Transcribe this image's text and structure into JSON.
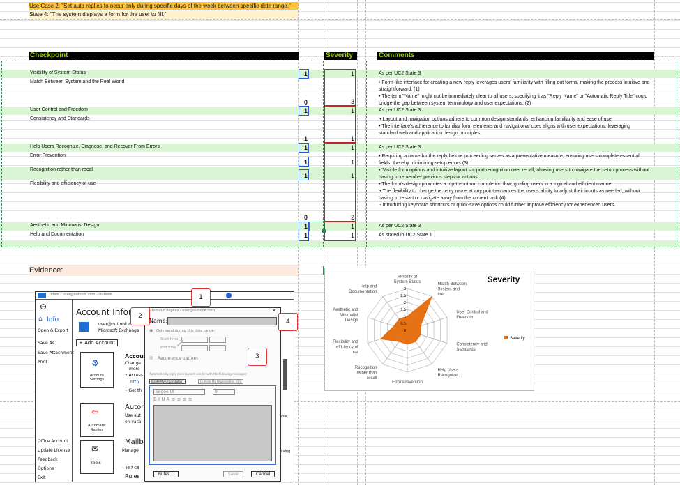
{
  "header": {
    "use_case": "Use Case 2: \"Set auto replies to occur only during specific days of the week between specific date range.\"",
    "state": "State 4: \"The system displays a form for the user to fill.\""
  },
  "table": {
    "col_checkpoint": "Checkpoint",
    "col_severity": "Severity",
    "col_comments": "Comments",
    "rows": [
      {
        "checkpoint": "Visibility of System Status",
        "blue": "1",
        "red": "1",
        "comment": "As per UC2 State 3"
      },
      {
        "checkpoint": "Match Between System and the Real World",
        "blue": "0",
        "red": "3",
        "comment": "• Form-like interface for creating a new reply leverages users' familiarity with filling out forms, making the process intuitive and straightforward. (1)\n• The term \"Name\" might not be immediately clear to all users; specifying it as \"Reply Name\" or \"Automatic Reply Title\" could bridge the gap between system terminology and user expectations. (2)"
      },
      {
        "checkpoint": "User Control and Freedom",
        "blue": "1",
        "red": "1",
        "comment": "As per UC2 State 3"
      },
      {
        "checkpoint": "Consistency and Standards",
        "blue": "1",
        "red": "1",
        "comment": "'• Layout and navigation options adhere to common design standards, enhancing familiarity and ease of use.\n• The interface's adherence to familiar form elements and navigational cues aligns with user expectations, leveraging standard web and application design principles."
      },
      {
        "checkpoint": "Help Users Recognize, Diagnose, and Recover From Errors",
        "blue": "1",
        "red": "1",
        "comment": "As per UC2 State 3"
      },
      {
        "checkpoint": "Error Prevention",
        "blue": "1",
        "red": "1",
        "comment": "• Requiring a name for the reply before proceeding serves as a preventative measure, ensuring users complete essential fields, thereby minimizing setup errors.(3)"
      },
      {
        "checkpoint": "Recognition rather than recall",
        "blue": "1",
        "red": "1",
        "comment": "• 'Visible form options and intuitive layout support recognition over recall, allowing users to navigate the setup process without having to remember previous steps or actions."
      },
      {
        "checkpoint": "Flexibility and efficiency of use",
        "blue": "0",
        "red": "2",
        "comment": "• The form's design promotes a top-to-bottom completion flow, guiding users in a logical and efficient manner.\n'• The flexibility to change the reply name at any point enhances the user's ability to adjust their inputs as needed, without having to restart or navigate away from the current task.(4)\n'- Introducing keyboard shortcuts or quick-save options could further improve efficiency for experienced users."
      },
      {
        "checkpoint": "Aesthetic and Minimalist Design",
        "blue": "1",
        "red": "1",
        "comment": "As per UC2 State 3"
      },
      {
        "checkpoint": "Help and Documentation",
        "blue": "1",
        "red": "1",
        "comment": "As stated in UC2 State 1"
      }
    ]
  },
  "evidence_label": "Evidence:",
  "sketch": {
    "title_bar": "Inbox - user@outlook.com - Outlook",
    "info": "Info",
    "open_export": "Open & Export",
    "save_as": "Save As",
    "save_attachment": "Save Attachment",
    "print": "Print",
    "office_account": "Office Account",
    "update_license": "Update License",
    "feedback": "Feedback",
    "options": "Options",
    "exit": "Exit",
    "account_info": "Account Information",
    "account_email": "user@outlook.com",
    "account_type": "Microsoft Exchange",
    "add_account": "+ Add Account",
    "account_settings": "Account Settings",
    "account_heading": "Account",
    "account_text1": "Change",
    "account_text2": "more",
    "account_bullet": "• Access",
    "account_link": "http",
    "account_get": "• Get th",
    "auto_replies_tile": "Automatic Replies",
    "auto_heading": "Auton",
    "auto_text1": "Use aut",
    "auto_text2": "on vaca",
    "tools_tile": "Tools",
    "mailbox_heading": "Mailb",
    "mailbox_text": "Manage",
    "mailbox_size": "• 98.7 GB",
    "rules_heading": "Rules",
    "side_text1": "ople,",
    "side_text2": "hiving",
    "dialog_title": "Automatic Replies - user@outlook.com",
    "dialog_close": "✕",
    "name_label": "Name:",
    "only_send": "Only send during this time range:",
    "start_time": "Start time",
    "end_time": "End time",
    "recurrence": "Recurrence pattern",
    "auto_reply_text": "Automatically reply once to each sender with the following messages:",
    "tab_inside": "Inside My Organization",
    "tab_outside": "Outside My Organization (On)",
    "font_name": "Segoe UI",
    "font_size": "9",
    "format_bar": "B I U A ≡ ≡ ≡ ≡",
    "rules_button": "Rules...",
    "save_button": "Save",
    "cancel_button": "Cancel",
    "callouts": [
      "1",
      "2",
      "3",
      "4"
    ]
  },
  "chart_data": {
    "type": "radar",
    "title": "Severity",
    "categories": [
      "Visibility of System Status",
      "Match Between System and the...",
      "User Control and Freedom",
      "Consistency and Standards",
      "Help Users Recognize,...",
      "Error Prevention",
      "Recognition rather than recall",
      "Flexibility and efficiency of use",
      "Aesthetic and Minimalist Design",
      "Help and Documentation"
    ],
    "series": [
      {
        "name": "Severity",
        "values": [
          1,
          3,
          1,
          1,
          1,
          1,
          1,
          2,
          1,
          1
        ],
        "color": "#e46c0a"
      }
    ],
    "ticks": [
      "0",
      "0.5",
      "1",
      "1.5",
      "2",
      "2.5",
      "3"
    ],
    "rmax": 3,
    "legend": "right"
  }
}
